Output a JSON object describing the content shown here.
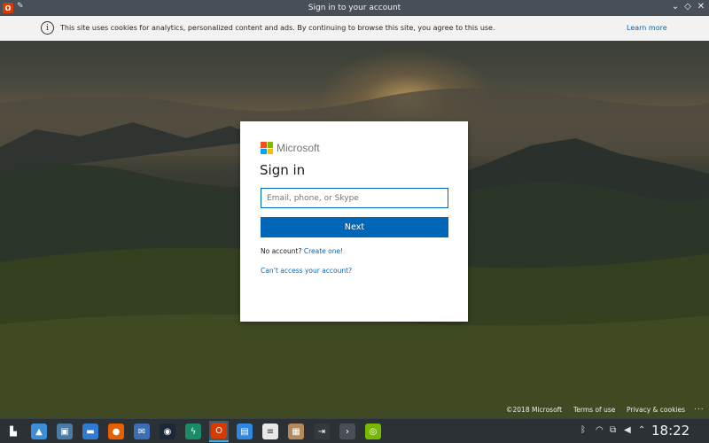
{
  "window": {
    "title": "Sign in to your account",
    "app_icon": "office-icon",
    "app_icon_glyph": "O",
    "controls": {
      "minimize": "⌄",
      "maximize": "◇",
      "close": "✕"
    }
  },
  "cookie_banner": {
    "message": "This site uses cookies for analytics, personalized content and ads. By continuing to browse this site, you agree to this use.",
    "link": "Learn more",
    "info_glyph": "i"
  },
  "signin": {
    "brand": "Microsoft",
    "heading": "Sign in",
    "email_placeholder": "Email, phone, or Skype",
    "email_value": "",
    "next_label": "Next",
    "no_account_text": "No account?",
    "create_link": "Create one!",
    "cant_access": "Can’t access your account?"
  },
  "footer": {
    "copyright": "©2018 Microsoft",
    "terms": "Terms of use",
    "privacy": "Privacy & cookies",
    "more": "..."
  },
  "taskbar": {
    "apps": [
      {
        "name": "app-launcher-icon",
        "glyph": "▙",
        "color": "#2c3136",
        "active": false
      },
      {
        "name": "image-viewer-icon",
        "glyph": "▲",
        "color": "#3a8fd8",
        "active": false
      },
      {
        "name": "system-settings-icon",
        "glyph": "▣",
        "color": "#4a7aa5",
        "active": false
      },
      {
        "name": "file-manager-icon",
        "glyph": "▬",
        "color": "#2f7bd1",
        "active": false
      },
      {
        "name": "firefox-icon",
        "glyph": "●",
        "color": "#e66000",
        "active": false
      },
      {
        "name": "thunderbird-icon",
        "glyph": "✉",
        "color": "#3a6fb5",
        "active": false
      },
      {
        "name": "steam-icon",
        "glyph": "◉",
        "color": "#1b2838",
        "active": false
      },
      {
        "name": "gitkraken-icon",
        "glyph": "ϟ",
        "color": "#1a8a67",
        "active": false
      },
      {
        "name": "office-icon",
        "glyph": "O",
        "color": "#d83b01",
        "active": true
      },
      {
        "name": "document-icon",
        "glyph": "▤",
        "color": "#2f88e0",
        "active": false
      },
      {
        "name": "text-editor-icon",
        "glyph": "≡",
        "color": "#e8e8e8",
        "active": false
      },
      {
        "name": "archive-icon",
        "glyph": "▦",
        "color": "#b48a5c",
        "active": false
      },
      {
        "name": "terminal-alt-icon",
        "glyph": "⇥",
        "color": "#34393e",
        "active": false
      },
      {
        "name": "terminal-icon",
        "glyph": "›",
        "color": "#4a4f55",
        "active": false
      },
      {
        "name": "nvidia-icon",
        "glyph": "◎",
        "color": "#76b900",
        "active": false
      }
    ],
    "tray": {
      "bluetooth": "ᛒ",
      "wifi": "◠",
      "clipboard": "⧉",
      "volume": "◀",
      "expand": "⌃"
    },
    "clock": "18:22"
  }
}
